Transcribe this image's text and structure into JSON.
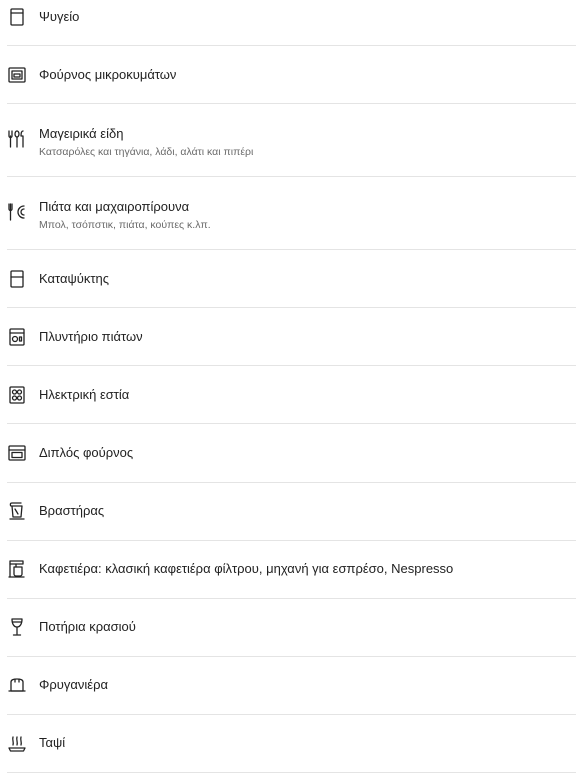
{
  "amenities": [
    {
      "title": "Ψυγείο",
      "subtitle": "",
      "icon": "fridge-icon"
    },
    {
      "title": "Φούρνος μικροκυμάτων",
      "subtitle": "",
      "icon": "microwave-icon"
    },
    {
      "title": "Μαγειρικά είδη",
      "subtitle": "Κατσαρόλες και τηγάνια, λάδι, αλάτι και πιπέρι",
      "icon": "cooking-basics-icon"
    },
    {
      "title": "Πιάτα και μαχαιροπίρουνα",
      "subtitle": "Μπολ, τσόπστικ, πιάτα, κούπες κ.λπ.",
      "icon": "dishes-silverware-icon"
    },
    {
      "title": "Καταψύκτης",
      "subtitle": "",
      "icon": "freezer-icon"
    },
    {
      "title": "Πλυντήριο πιάτων",
      "subtitle": "",
      "icon": "dishwasher-icon"
    },
    {
      "title": "Ηλεκτρική εστία",
      "subtitle": "",
      "icon": "electric-stove-icon"
    },
    {
      "title": "Διπλός φούρνος",
      "subtitle": "",
      "icon": "double-oven-icon"
    },
    {
      "title": "Βραστήρας",
      "subtitle": "",
      "icon": "kettle-icon"
    },
    {
      "title": "Καφετιέρα: κλασική καφετιέρα φίλτρου, μηχανή για εσπρέσο, Nespresso",
      "subtitle": "",
      "icon": "coffee-maker-icon"
    },
    {
      "title": "Ποτήρια κρασιού",
      "subtitle": "",
      "icon": "wine-glass-icon"
    },
    {
      "title": "Φρυγανιέρα",
      "subtitle": "",
      "icon": "toaster-icon"
    },
    {
      "title": "Ταψί",
      "subtitle": "",
      "icon": "baking-sheet-icon"
    }
  ]
}
